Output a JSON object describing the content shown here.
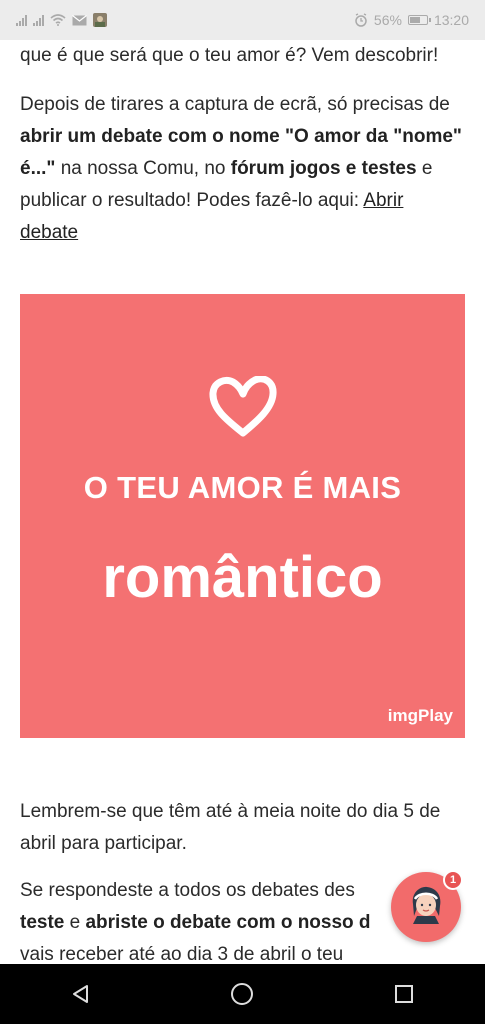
{
  "status_bar": {
    "time": "13:20",
    "battery_percent": "56%",
    "icons": [
      "signal-icon",
      "signal-icon",
      "wifi-icon",
      "mail-icon",
      "photo-icon",
      "alarm-icon",
      "battery-icon"
    ]
  },
  "article": {
    "p1": "que é que será que o teu amor é? Vem descobrir!",
    "p2": {
      "t1": "Depois de tirares a captura de ecrã, só precisas de ",
      "b1": "abrir um debate com o nome \"O amor da \"nome\" é...\"",
      "t2": " na nossa Comu, no ",
      "b2": "fórum jogos e testes",
      "t3": " e publicar o resultado! Podes fazê-lo aqui: ",
      "link": "Abrir debate"
    },
    "p3": "Lembrem-se que têm até à meia noite do dia 5 de abril para participar.",
    "p4": {
      "t1": "Se respondeste a todos os debates des",
      "b1": "teste",
      "t2": " e ",
      "b2": "abriste o debate com o nosso d",
      "t3": "vais receber até ao dia 3 de abril o teu"
    }
  },
  "banner": {
    "line1": "O TEU AMOR É MAIS",
    "line2": "romântico",
    "watermark": "imgPlay",
    "background": "#f47172"
  },
  "fab": {
    "badge": "1"
  },
  "nav": {
    "icons": [
      "back-icon",
      "home-icon",
      "recents-icon"
    ]
  }
}
